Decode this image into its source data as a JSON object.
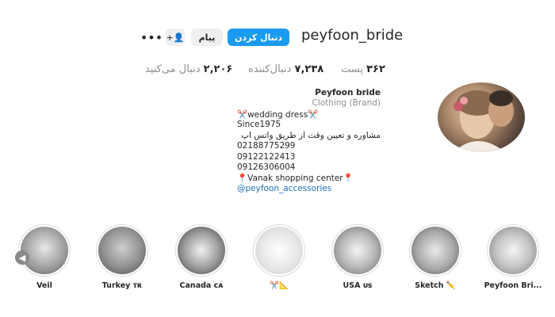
{
  "profile": {
    "username": "peyfoon_bride",
    "follow_label": "دنبال کردن",
    "message_label": "پیام",
    "suggest_icon": "person-plus-icon",
    "suggest_glyph": "+👤",
    "more_glyph": "•••"
  },
  "stats": {
    "posts_num": "۳۶۲",
    "posts_label": "پست",
    "followers_num": "۷,۲۳۸",
    "followers_label": "دنبال‌کننده",
    "following_num": "۲,۲۰۶",
    "following_label": "دنبال می‌کنید"
  },
  "bio": {
    "name": "Peyfoon bride",
    "category": "Clothing (Brand)",
    "line1": "✂️wedding dress✂️",
    "line2": "Since1975",
    "line3": "مشاوره و تعیین وقت از طریق واتس اپ",
    "line4": "02188775299",
    "line5": "09122122413",
    "line6": "09126306004",
    "line7": "📍Vanak shopping center📍",
    "mention": "@peyfoon_accessories"
  },
  "highlights": [
    {
      "label": "Veil"
    },
    {
      "label": "Turkey ᴛʀ"
    },
    {
      "label": "Canada ᴄᴀ"
    },
    {
      "label": "✂️📐"
    },
    {
      "label": "USA ᴜs"
    },
    {
      "label": "Sketch ✏️"
    },
    {
      "label": "Peyfoon Bri..."
    }
  ],
  "colors": {
    "accent": "#1a9bf0",
    "secondary_button": "#efefef",
    "muted_text": "#8e8e8e",
    "mention": "#1d6fb8"
  }
}
